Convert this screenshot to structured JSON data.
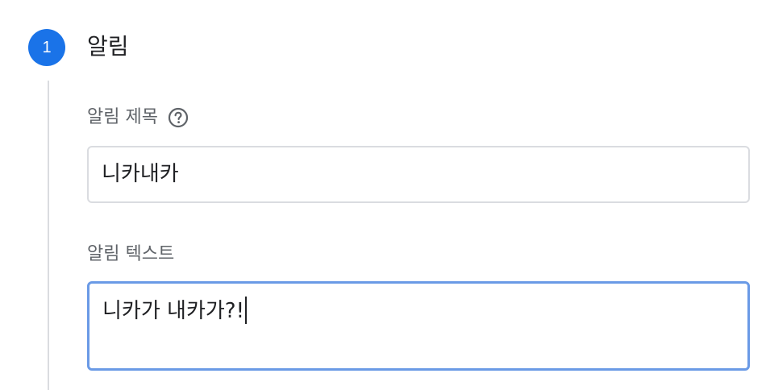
{
  "step": {
    "number": "1",
    "title": "알림"
  },
  "fields": {
    "notification_title": {
      "label": "알림 제목",
      "help_icon": "help-circle-icon",
      "value": "니카내카"
    },
    "notification_text": {
      "label": "알림 텍스트",
      "value": "니카가 내카가?!"
    }
  },
  "colors": {
    "accent": "#1a73e8",
    "focused_border": "#6a9ae6",
    "border": "#dadce0",
    "label": "#5f6368",
    "text": "#202124"
  }
}
